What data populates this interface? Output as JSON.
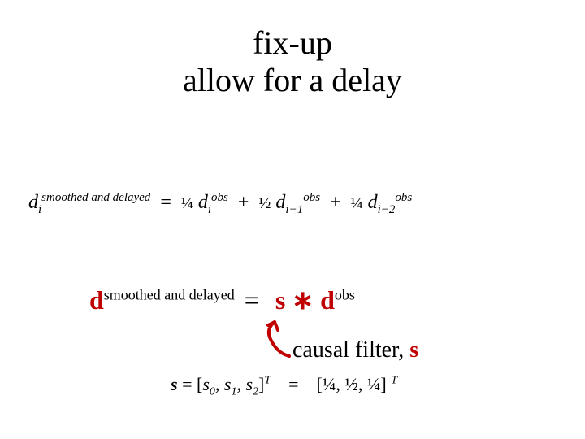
{
  "title_line1": "fix-up",
  "title_line2": "allow for a delay",
  "eq1": {
    "d": "d",
    "sub_i": "i",
    "sup_smoothed": "smoothed and delayed",
    "eq": "=",
    "q14": "¼",
    "q12": "½",
    "sup_obs": "obs",
    "sub_im1": "i−1",
    "sub_im2": "i−2",
    "plus": "+"
  },
  "eq2": {
    "d": "d",
    "sup_smoothed": "smoothed and delayed",
    "eq": "=",
    "s": "s",
    "conv": "∗",
    "sup_obs": "obs"
  },
  "causal": {
    "label": "causal filter, ",
    "s": "s"
  },
  "eq3": {
    "s_bold": "s",
    "eq": "=",
    "lb": "[",
    "rb": "]",
    "s0": "s",
    "s0sub": "0",
    "s1": "s",
    "s1sub": "1",
    "s2": "s",
    "s2sub": "2",
    "comma": ", ",
    "T": "T",
    "q14": "¼",
    "q12": "½"
  }
}
